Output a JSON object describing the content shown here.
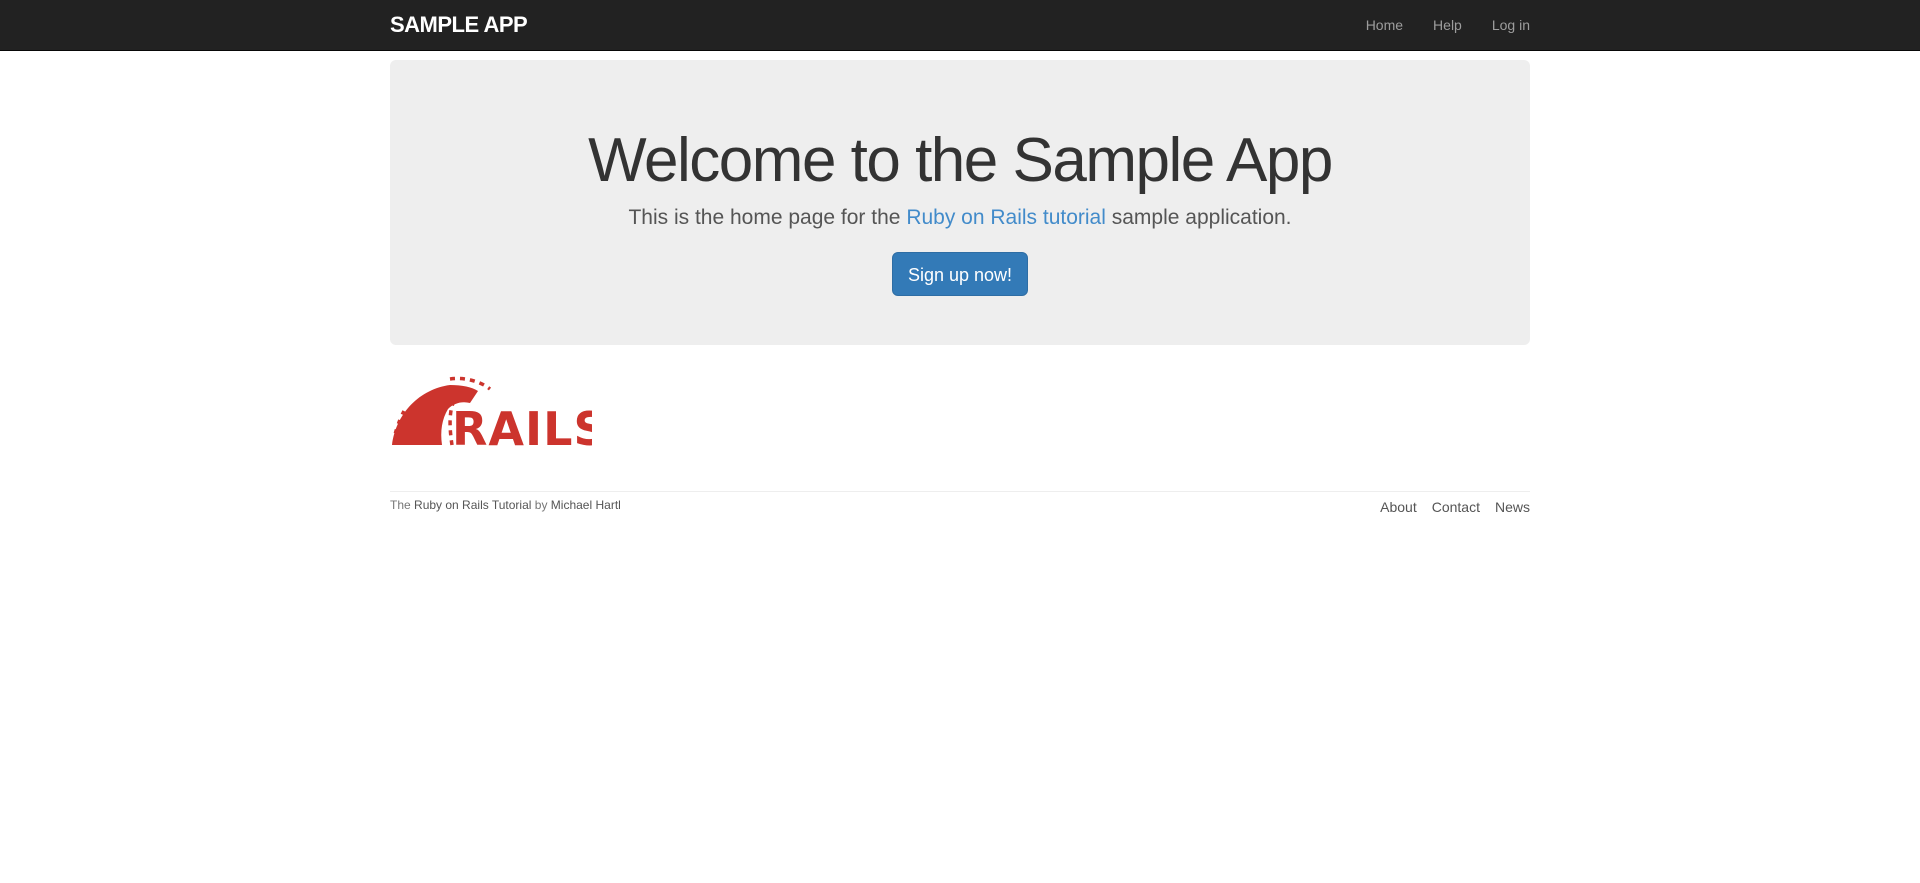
{
  "header": {
    "logo": "SAMPLE APP",
    "nav": [
      {
        "label": "Home"
      },
      {
        "label": "Help"
      },
      {
        "label": "Log in"
      }
    ]
  },
  "hero": {
    "title": "Welcome to the Sample App",
    "lead_prefix": "This is the home page for the",
    "lead_link": "Ruby on Rails tutorial",
    "lead_suffix": "sample application.",
    "signup_button": "Sign up now!"
  },
  "rails_logo": {
    "icon": "rails-logo-icon",
    "text": "RAILS",
    "color": "#cc342d"
  },
  "footer": {
    "credit_the": "The",
    "credit_link": "Ruby on Rails Tutorial",
    "credit_by": "by",
    "author_link": "Michael Hartl",
    "links": [
      {
        "label": "About"
      },
      {
        "label": "Contact"
      },
      {
        "label": "News"
      }
    ]
  },
  "colors": {
    "navbar_bg": "#222222",
    "jumbotron_bg": "#eeeeee",
    "primary_button": "#337ab7",
    "link": "#428bca",
    "rails_red": "#cc342d"
  }
}
